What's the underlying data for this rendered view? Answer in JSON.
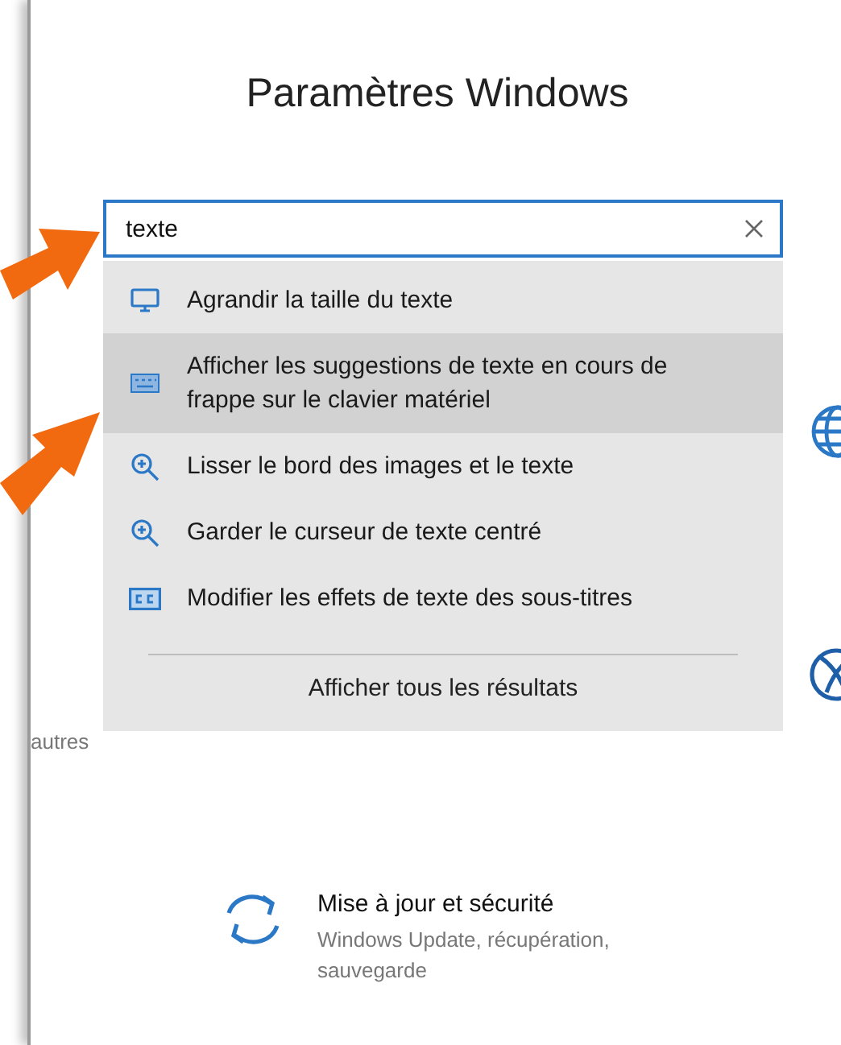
{
  "window": {
    "title": "Paramètres Windows"
  },
  "search": {
    "value": "texte"
  },
  "results": [
    {
      "kind": "display",
      "label": "Agrandir la taille du texte",
      "selected": false
    },
    {
      "kind": "keyboard",
      "label": "Afficher les suggestions de texte en cours de frappe sur le clavier matériel",
      "selected": true
    },
    {
      "kind": "magnifier",
      "label": "Lisser le bord des images et le texte",
      "selected": false
    },
    {
      "kind": "magnifier",
      "label": "Garder le curseur de texte centré",
      "selected": false
    },
    {
      "kind": "captions",
      "label": "Modifier les effets de texte des sous-titres",
      "selected": false
    }
  ],
  "show_all": "Afficher tous les résultats",
  "background_text": "autres",
  "categories": [
    {
      "title": "Mise à jour et sécurité",
      "description": "Windows Update, récupération, sauvegarde"
    }
  ]
}
